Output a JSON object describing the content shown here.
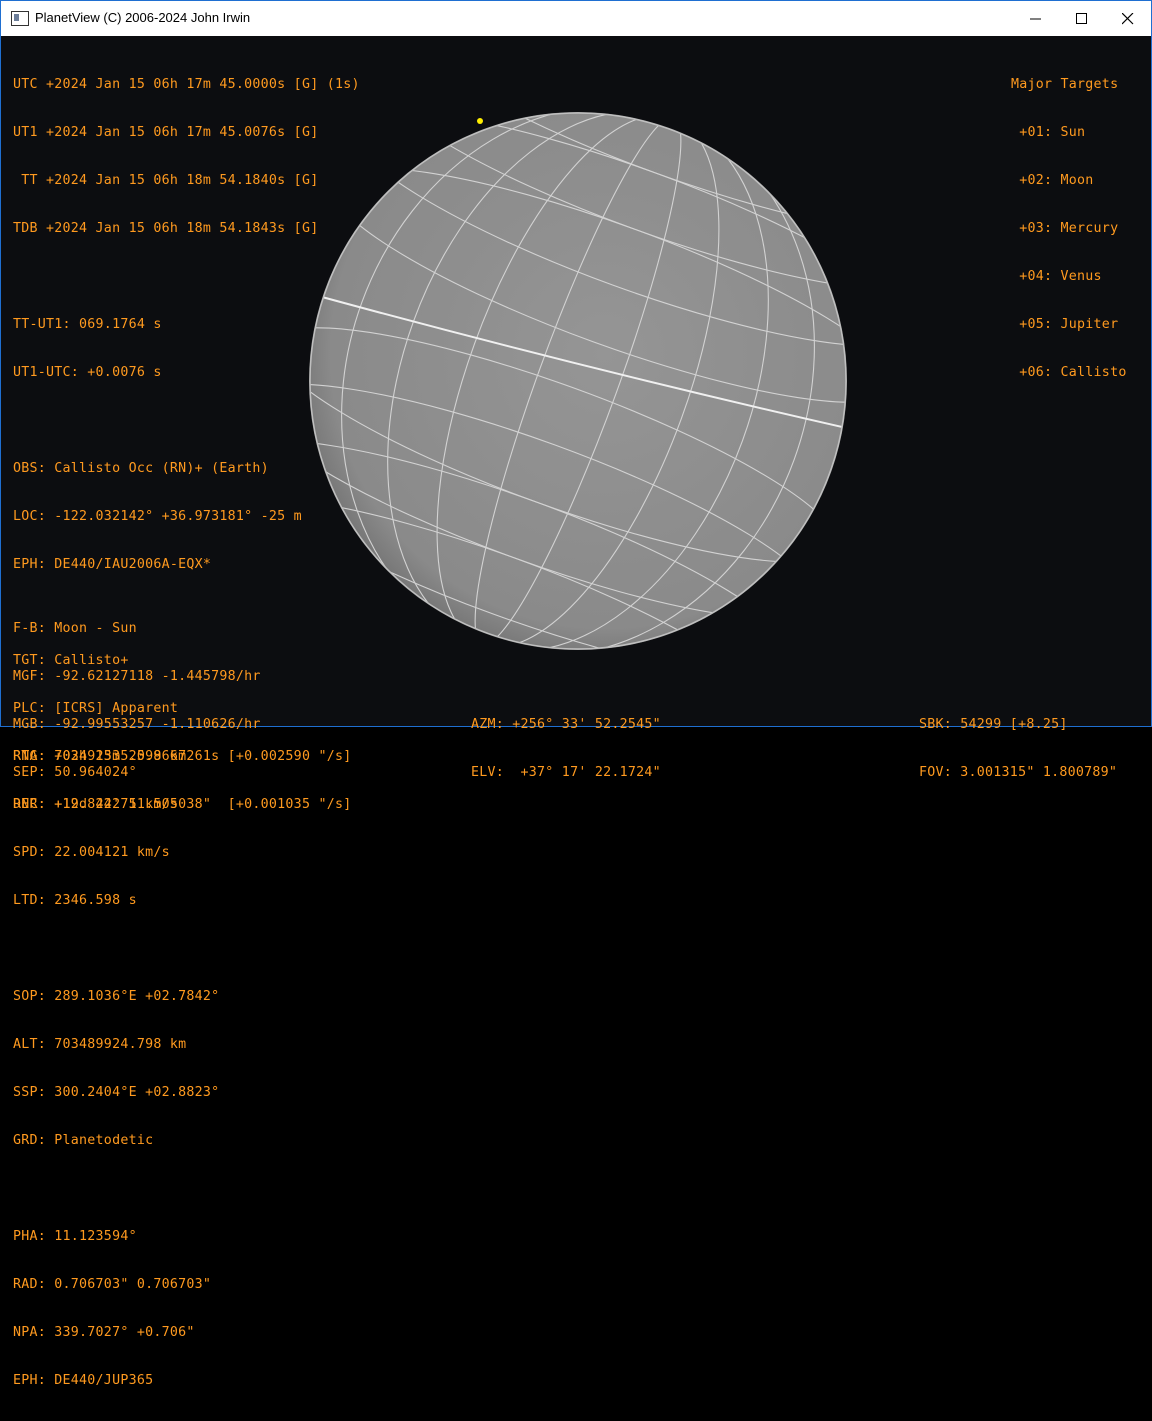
{
  "window": {
    "title": "PlanetView (C) 2006-2024 John Irwin",
    "controls": [
      "minimize",
      "maximize",
      "close"
    ]
  },
  "time": {
    "utc": "UTC +2024 Jan 15 06h 17m 45.0000s [G] (1s)",
    "ut1": "UT1 +2024 Jan 15 06h 17m 45.0076s [G]",
    "tt": " TT +2024 Jan 15 06h 18m 54.1840s [G]",
    "tdb": "TDB +2024 Jan 15 06h 18m 54.1843s [G]",
    "tt_ut1": "TT-UT1: 069.1764 s",
    "ut1_utc": "UT1-UTC: +0.0076 s"
  },
  "observer": {
    "obs": "OBS: Callisto Occ (RN)+ (Earth)",
    "loc": "LOC: -122.032142° +36.973181° -25 m",
    "eph": "EPH: DE440/IAU2006A-EQX*"
  },
  "target": {
    "tgt": "TGT: Callisto+",
    "rng": "RNG: 703492335.098 km",
    "rnr": "RNR: +19.842275 km/s",
    "spd": "SPD: 22.004121 km/s",
    "ltd": "LTD: 2346.598 s",
    "sop": "SOP: 289.1036°E +02.7842°",
    "alt": "ALT: 703489924.798 km",
    "ssp": "SSP: 300.2404°E +02.8823°",
    "grd": "GRD: Planetodetic",
    "pha": "PHA: 11.123594°",
    "rad": "RAD: 0.706703\" 0.706703\"",
    "npa": "NPA: 339.7027° +0.706\"",
    "eph": "EPH: DE440/JUP365"
  },
  "magnitudes": {
    "fb": "F-B: Moon - Sun",
    "mgf": "MGF: -92.62127118 -1.445798/hr",
    "mgb": "MGB: -92.99553257 -1.110626/hr",
    "sep": "SEP: 50.964024°"
  },
  "position": {
    "plc": "PLC: [ICRS] Apparent",
    "rta": "RTA: +02h 15m 25.9667261s [+0.002590 \"/s]",
    "dec": "DEC: +12d 24' 11.505038\"  [+0.001035 \"/s]",
    "azm": "AZM: +256° 33' 52.2545\"",
    "elv": "ELV:  +37° 17' 22.1724\"",
    "sbk": "SBK: 54299 [+8.25]",
    "fov": "FOV: 3.001315\" 1.800789\""
  },
  "targets": {
    "heading": "Major Targets",
    "items": [
      " +01: Sun",
      " +02: Moon",
      " +03: Mercury",
      " +04: Venus",
      " +05: Jupiter",
      " +06: Callisto"
    ]
  },
  "colors": {
    "text": "#ff9a1f",
    "background": "#0c0d10",
    "globe_fill": "#8c8c8c",
    "grid": "#d4d4d4",
    "marker": "#ffee00"
  }
}
